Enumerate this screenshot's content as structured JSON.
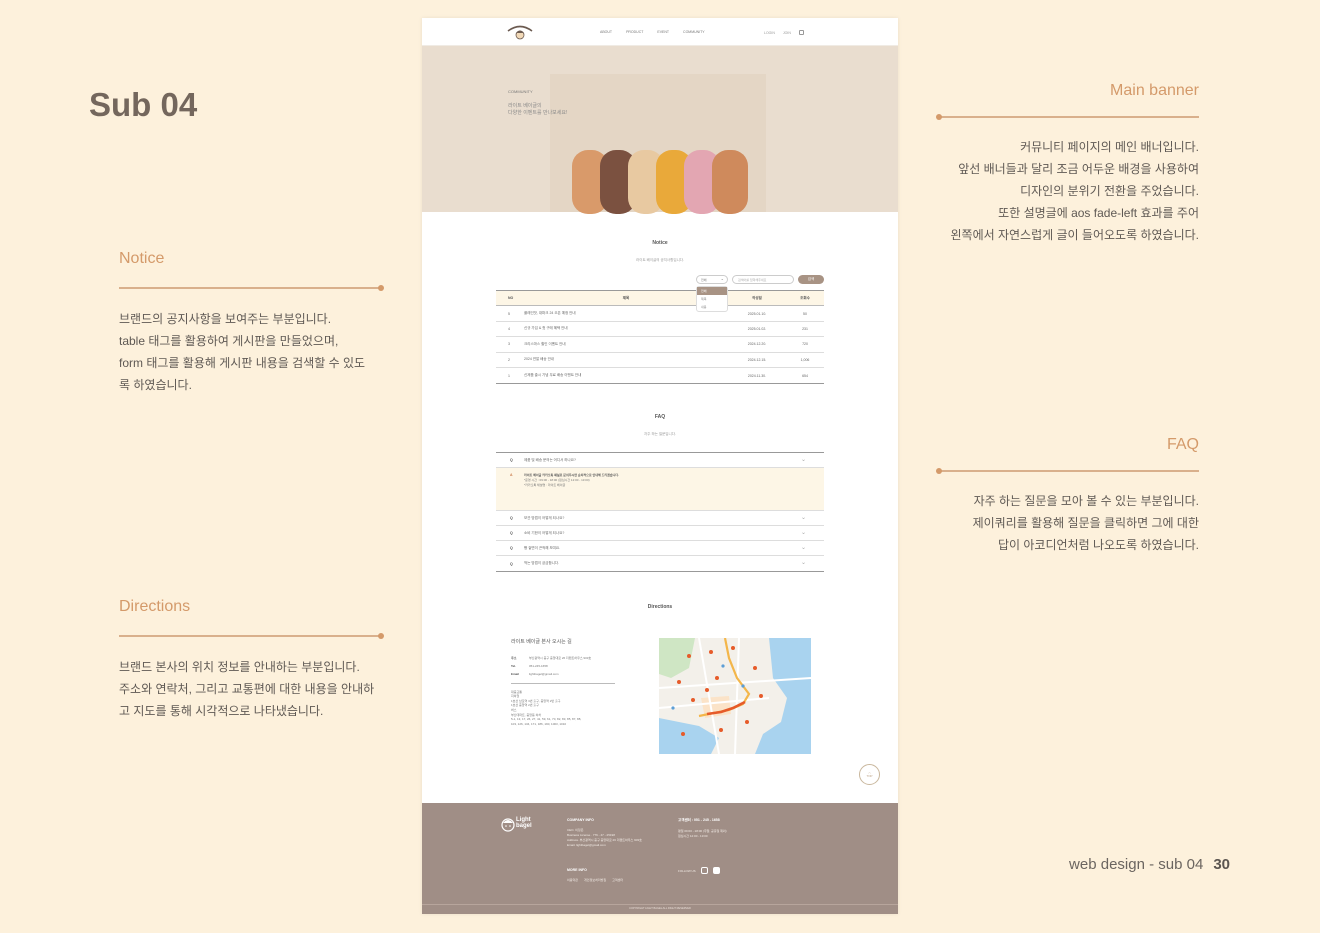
{
  "slide": {
    "title": "Sub 04",
    "caption": "web design - sub 04",
    "page_number": "30"
  },
  "annotations": {
    "main_banner": {
      "title": "Main banner",
      "body": "커뮤니티 페이지의 메인 배너입니다.\n앞선 배너들과 달리 조금 어두운 배경을 사용하여\n디자인의 분위기 전환을 주었습니다.\n또한 설명글에 aos fade-left 효과를 주어\n왼쪽에서 자연스럽게 글이 들어오도록 하였습니다."
    },
    "notice": {
      "title": "Notice",
      "body": "브랜드의 공지사항을 보여주는 부분입니다.\ntable 태그를 활용하여 게시판을 만들었으며,\nform 태그를 활용해 게시판 내용을 검색할 수 있도\n록 하였습니다."
    },
    "faq": {
      "title": "FAQ",
      "body": "자주 하는 질문을 모아 볼 수 있는 부분입니다.\n제이쿼리를 활용해 질문을 클릭하면 그에 대한\n답이 아코디언처럼 나오도록 하였습니다."
    },
    "directions": {
      "title": "Directions",
      "body": "브랜드 본사의 위치 정보를 안내하는 부분입니다.\n주소와 연락처, 그리고 교통편에 대한 내용을 안내하\n고 지도를 통해 시각적으로 나타냈습니다."
    }
  },
  "mock": {
    "logo_text": "Light bagel",
    "nav": [
      "ABOUT",
      "PRODUCT",
      "EVENT",
      "COMMUNITY"
    ],
    "util": [
      "LOGIN",
      "JOIN"
    ],
    "banner": {
      "label": "COMMUNITY",
      "copy": "라이트 베이글의\n다양한 이벤트를 만나보세요!"
    },
    "notice": {
      "title": "Notice",
      "subtitle": "라이트 베이글의 공지사항입니다.",
      "select_value": "전체",
      "select_options": [
        "전체",
        "제목",
        "내용"
      ],
      "search_placeholder": "검색어를 입력해주세요",
      "search_button": "검색",
      "columns": [
        "NO",
        "제목",
        "작성일",
        "조회수"
      ],
      "rows": [
        {
          "no": "5",
          "title": "플레인맛, 대파크 24 오픈 예정 안내",
          "date": "2025.01.10.",
          "views": "50"
        },
        {
          "no": "4",
          "title": "신규 가입 & 첫 구매 혜택 안내",
          "date": "2025.01.02.",
          "views": "231"
        },
        {
          "no": "3",
          "title": "크리스마스 할인 이벤트 안내",
          "date": "2024.12.20.",
          "views": "720"
        },
        {
          "no": "2",
          "title": "2024 연말 배송 안내",
          "date": "2024.12.15.",
          "views": "1,006"
        },
        {
          "no": "1",
          "title": "신제품 출시 기념 무료 배송 이벤트 안내",
          "date": "2024.11.30.",
          "views": "654"
        }
      ]
    },
    "faq": {
      "title": "FAQ",
      "subtitle": "자주 하는 질문입니다.",
      "q_mark": "Q",
      "a_mark": "A",
      "open_question": "제품 및 배송 문의는 어디서 하나요?",
      "answer_lead": "라이트 베이글 카카오톡 채널로 문의주시면 순차적으로 안내해 드리겠습니다.",
      "answer_rest": "*운영 시간 : 09:00 - 18:00 (점심시간 12:00 - 13:00)\n*카카오톡 채널명 : 라이트 베이글",
      "questions": [
        "보관 방법이 어떻게 되나요?",
        "소비 기한이 어떻게 되나요?",
        "빵 겉면이 끈적해 보여요.",
        "먹는 방법이 궁금합니다."
      ]
    },
    "directions": {
      "title": "Directions",
      "head": "라이트 베이글 본사 오시는 길",
      "address_label": "주소",
      "address": "부산광역시 중구 중앙대로 26 더펜트하우스 903호",
      "tel_label": "Tel.",
      "tel": "051-245-1658",
      "email_label": "Email",
      "email": "lightbagel@gmail.com",
      "transit": "대중교통\n지하철\n1호선 남포역 3번 출구, 중앙역 2번 출구\n1호선 중앙역 2번 출구\n버스\n부산데파트, 중앙동 하차\n5-1, 13, 17, 26, 27, 41, 59, 61, 70, 82, 83, 85, 87, 88,\n103, 126, 134, 171, 186, 190, 1003, 1010"
    },
    "top_button": "TOP",
    "footer": {
      "logo_text": "Light bagel",
      "company_head": "COMPANY INFO",
      "company_lines": "CEO. 이정은\nBusiness License . 776 - 47 - 25198\nAddress. 부산광역시 중구 중앙대로 26 더펜트하우스 903호\nEmail. lightbagel@gmail.com",
      "cs_head": "고객센터 : 051 - 245 - 1658",
      "cs_lines": "평일 09:00 - 18:00 (주말, 공휴일 제외)\n점심시간 12:00 - 13:00",
      "more_head": "MORE INFO",
      "more_links": [
        "이용약관",
        "개인정보처리방침",
        "고객센터"
      ],
      "follow": "FOLLOW US",
      "copyright": "COPYRIGHT LIGHT BAGEL ALL RIGHT RESERVED"
    }
  },
  "colors": {
    "background": "#fdf1dc",
    "accent": "#d49a6a",
    "footer": "#a08e86"
  }
}
